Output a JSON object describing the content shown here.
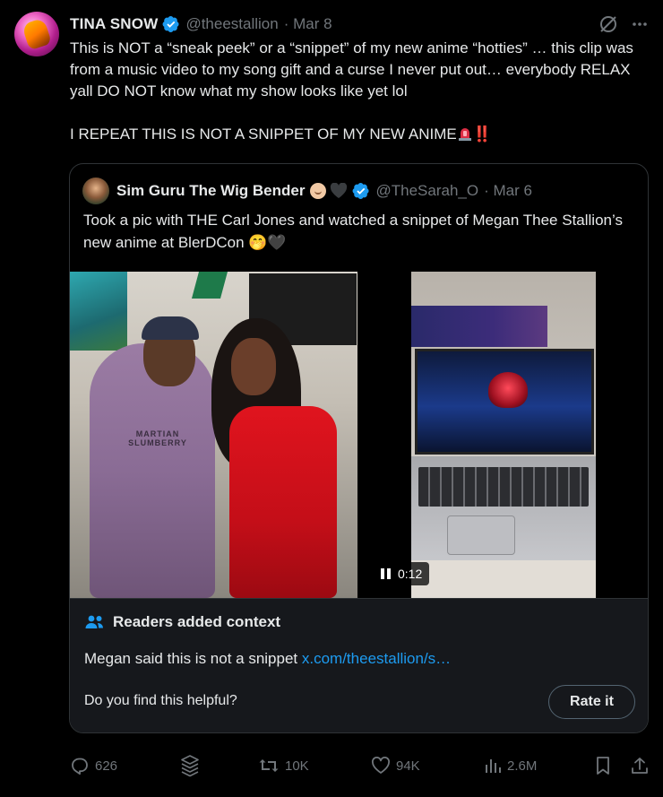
{
  "author": {
    "name": "TINA SNOW",
    "handle": "@theestallion",
    "date": "· Mar 8"
  },
  "tweet": {
    "line1": "This is NOT a “sneak peek” or a “snippet” of my new anime “hotties” … this clip was from a music video to my song gift and a curse I never put out… everybody RELAX yall DO NOT know what my show looks like yet lol",
    "line2": "I REPEAT THIS IS NOT A SNIPPET OF MY NEW ANIME",
    "line2_suffix": "‼️"
  },
  "quote": {
    "name": "Sim Guru The Wig Bender",
    "handle": "@TheSarah_O",
    "date": "· Mar 6",
    "text": "Took a pic with THE Carl Jones and watched a snippet of Megan Thee Stallion’s new anime at BlerDCon 🤭🖤",
    "photo_logo_text": "MARTIAN\nSLUMBERRY",
    "video_time": "0:12"
  },
  "context": {
    "heading": "Readers added context",
    "body": "Megan said this is not a snippet ",
    "link": "x.com/theestallion/s…",
    "question": "Do you find this helpful?",
    "rate_label": "Rate it"
  },
  "actions": {
    "replies": "626",
    "retweets": "10K",
    "likes": "94K",
    "views": "2.6M"
  },
  "colors": {
    "background": "#000000",
    "text": "#e7e9ea",
    "muted": "#71767b",
    "link": "#1d9bf0",
    "border": "#2f3336"
  },
  "icons": [
    "verified-badge-icon",
    "grok-icon",
    "more-icon",
    "reply-icon",
    "stack-icon",
    "retweet-icon",
    "like-icon",
    "views-icon",
    "bookmark-icon",
    "share-icon",
    "people-icon",
    "pause-icon"
  ]
}
